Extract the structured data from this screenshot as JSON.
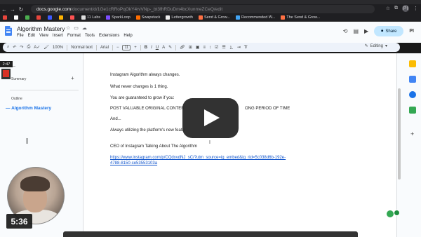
{
  "browser": {
    "url_domain": "docs.google.com",
    "url_path": "/document/d/1Ge1cRRoPqOkY4rvVNp-_bt3fhRDuDm4bcXunmeZCeQ/edit",
    "profile_initial": "PI",
    "bookmarks": [
      {
        "label": "",
        "color": "#e8453c"
      },
      {
        "label": "",
        "color": "#ffffff"
      },
      {
        "label": "",
        "color": "#4caf50"
      },
      {
        "label": "",
        "color": "#e8453c"
      },
      {
        "label": "",
        "color": "#3d5afe"
      },
      {
        "label": "",
        "color": "#ffb300"
      },
      {
        "label": "",
        "color": "#ff5252"
      },
      {
        "label": "11 Labs",
        "color": "#dddddd"
      },
      {
        "label": "SparkLoop",
        "color": "#7c4dff"
      },
      {
        "label": "Swapstack",
        "color": "#ff6d00"
      },
      {
        "label": "Lettergrowth",
        "color": "#eeeeee"
      },
      {
        "label": "Send & Grow...",
        "color": "#ff7043"
      },
      {
        "label": "Recommended W...",
        "color": "#42a5f5"
      },
      {
        "label": "The Send & Grow...",
        "color": "#ff7043"
      }
    ]
  },
  "docs": {
    "title": "Algorithm Mastery",
    "menu": [
      "File",
      "Edit",
      "View",
      "Insert",
      "Format",
      "Tools",
      "Extensions",
      "Help"
    ],
    "share_label": "Share",
    "toolbar": {
      "zoom": "100%",
      "style": "Normal text",
      "font": "Arial",
      "font_size": "11",
      "mode": "Editing"
    }
  },
  "outline_panel": {
    "summary_label": "Summary",
    "outline_label": "Outline",
    "items": [
      "Algorithm Mastery"
    ]
  },
  "document": {
    "paragraphs": [
      "Instagram Algorithm always changes.",
      "What never changes is 1 thing.",
      "You are guaranteed to grow if you:",
      "POST VALUABLE ORIGINAL CONTEN",
      "ONG PERIOD OF TIME",
      "And...",
      "Always utilizing the platform's new featu",
      "CEO of Instagram Talking About The Algorithm"
    ],
    "link": "https://www.instagram.com/p/CQdxvdNJ_sC/?utm_source=ig_embed&ig_rid=5c038d6b-192e-4788-8150-ce53553103a"
  },
  "video": {
    "recording_time": "2:47",
    "duration": "5:36"
  }
}
